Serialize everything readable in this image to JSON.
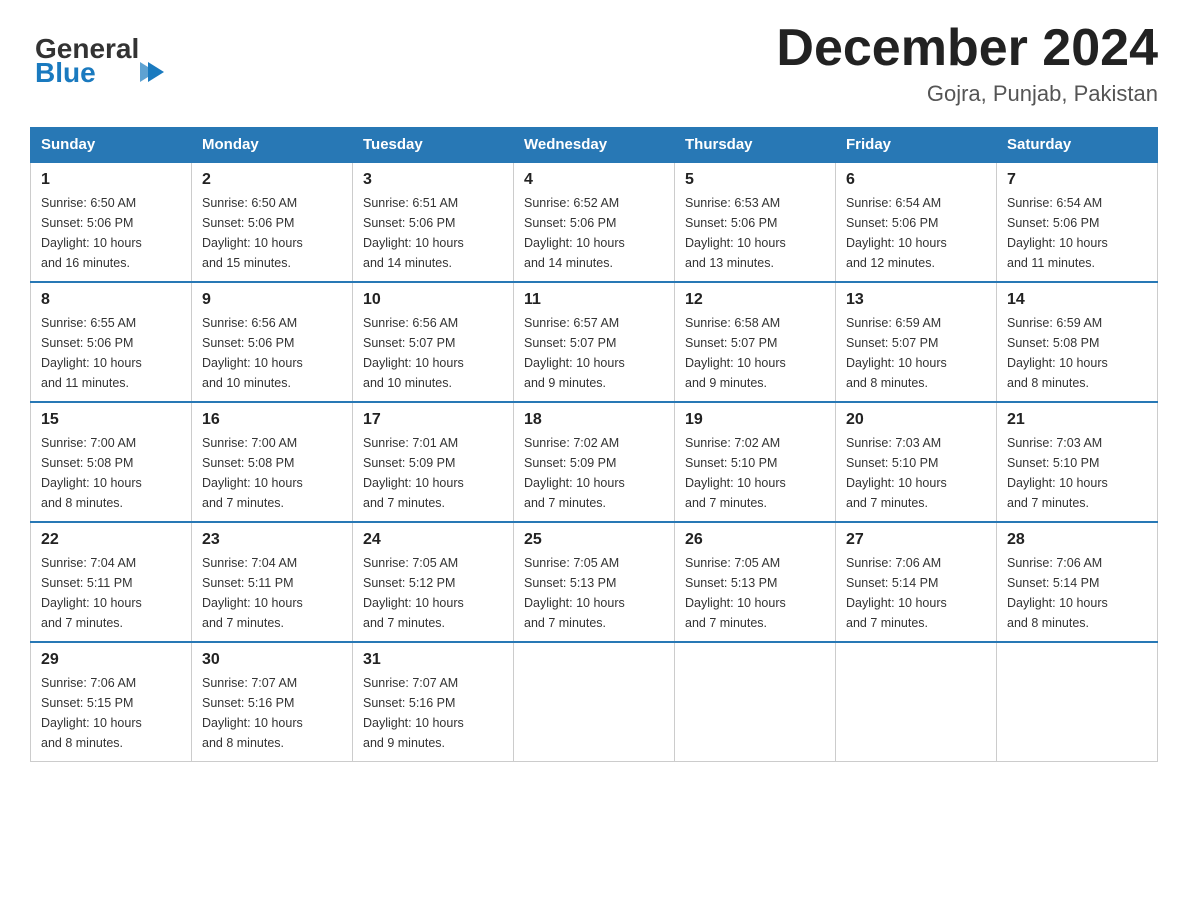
{
  "header": {
    "logo_general": "General",
    "logo_blue": "Blue",
    "month_title": "December 2024",
    "location": "Gojra, Punjab, Pakistan"
  },
  "days_of_week": [
    "Sunday",
    "Monday",
    "Tuesday",
    "Wednesday",
    "Thursday",
    "Friday",
    "Saturday"
  ],
  "weeks": [
    [
      {
        "day": "1",
        "sunrise": "6:50 AM",
        "sunset": "5:06 PM",
        "daylight": "10 hours and 16 minutes."
      },
      {
        "day": "2",
        "sunrise": "6:50 AM",
        "sunset": "5:06 PM",
        "daylight": "10 hours and 15 minutes."
      },
      {
        "day": "3",
        "sunrise": "6:51 AM",
        "sunset": "5:06 PM",
        "daylight": "10 hours and 14 minutes."
      },
      {
        "day": "4",
        "sunrise": "6:52 AM",
        "sunset": "5:06 PM",
        "daylight": "10 hours and 14 minutes."
      },
      {
        "day": "5",
        "sunrise": "6:53 AM",
        "sunset": "5:06 PM",
        "daylight": "10 hours and 13 minutes."
      },
      {
        "day": "6",
        "sunrise": "6:54 AM",
        "sunset": "5:06 PM",
        "daylight": "10 hours and 12 minutes."
      },
      {
        "day": "7",
        "sunrise": "6:54 AM",
        "sunset": "5:06 PM",
        "daylight": "10 hours and 11 minutes."
      }
    ],
    [
      {
        "day": "8",
        "sunrise": "6:55 AM",
        "sunset": "5:06 PM",
        "daylight": "10 hours and 11 minutes."
      },
      {
        "day": "9",
        "sunrise": "6:56 AM",
        "sunset": "5:06 PM",
        "daylight": "10 hours and 10 minutes."
      },
      {
        "day": "10",
        "sunrise": "6:56 AM",
        "sunset": "5:07 PM",
        "daylight": "10 hours and 10 minutes."
      },
      {
        "day": "11",
        "sunrise": "6:57 AM",
        "sunset": "5:07 PM",
        "daylight": "10 hours and 9 minutes."
      },
      {
        "day": "12",
        "sunrise": "6:58 AM",
        "sunset": "5:07 PM",
        "daylight": "10 hours and 9 minutes."
      },
      {
        "day": "13",
        "sunrise": "6:59 AM",
        "sunset": "5:07 PM",
        "daylight": "10 hours and 8 minutes."
      },
      {
        "day": "14",
        "sunrise": "6:59 AM",
        "sunset": "5:08 PM",
        "daylight": "10 hours and 8 minutes."
      }
    ],
    [
      {
        "day": "15",
        "sunrise": "7:00 AM",
        "sunset": "5:08 PM",
        "daylight": "10 hours and 8 minutes."
      },
      {
        "day": "16",
        "sunrise": "7:00 AM",
        "sunset": "5:08 PM",
        "daylight": "10 hours and 7 minutes."
      },
      {
        "day": "17",
        "sunrise": "7:01 AM",
        "sunset": "5:09 PM",
        "daylight": "10 hours and 7 minutes."
      },
      {
        "day": "18",
        "sunrise": "7:02 AM",
        "sunset": "5:09 PM",
        "daylight": "10 hours and 7 minutes."
      },
      {
        "day": "19",
        "sunrise": "7:02 AM",
        "sunset": "5:10 PM",
        "daylight": "10 hours and 7 minutes."
      },
      {
        "day": "20",
        "sunrise": "7:03 AM",
        "sunset": "5:10 PM",
        "daylight": "10 hours and 7 minutes."
      },
      {
        "day": "21",
        "sunrise": "7:03 AM",
        "sunset": "5:10 PM",
        "daylight": "10 hours and 7 minutes."
      }
    ],
    [
      {
        "day": "22",
        "sunrise": "7:04 AM",
        "sunset": "5:11 PM",
        "daylight": "10 hours and 7 minutes."
      },
      {
        "day": "23",
        "sunrise": "7:04 AM",
        "sunset": "5:11 PM",
        "daylight": "10 hours and 7 minutes."
      },
      {
        "day": "24",
        "sunrise": "7:05 AM",
        "sunset": "5:12 PM",
        "daylight": "10 hours and 7 minutes."
      },
      {
        "day": "25",
        "sunrise": "7:05 AM",
        "sunset": "5:13 PM",
        "daylight": "10 hours and 7 minutes."
      },
      {
        "day": "26",
        "sunrise": "7:05 AM",
        "sunset": "5:13 PM",
        "daylight": "10 hours and 7 minutes."
      },
      {
        "day": "27",
        "sunrise": "7:06 AM",
        "sunset": "5:14 PM",
        "daylight": "10 hours and 7 minutes."
      },
      {
        "day": "28",
        "sunrise": "7:06 AM",
        "sunset": "5:14 PM",
        "daylight": "10 hours and 8 minutes."
      }
    ],
    [
      {
        "day": "29",
        "sunrise": "7:06 AM",
        "sunset": "5:15 PM",
        "daylight": "10 hours and 8 minutes."
      },
      {
        "day": "30",
        "sunrise": "7:07 AM",
        "sunset": "5:16 PM",
        "daylight": "10 hours and 8 minutes."
      },
      {
        "day": "31",
        "sunrise": "7:07 AM",
        "sunset": "5:16 PM",
        "daylight": "10 hours and 9 minutes."
      },
      null,
      null,
      null,
      null
    ]
  ]
}
